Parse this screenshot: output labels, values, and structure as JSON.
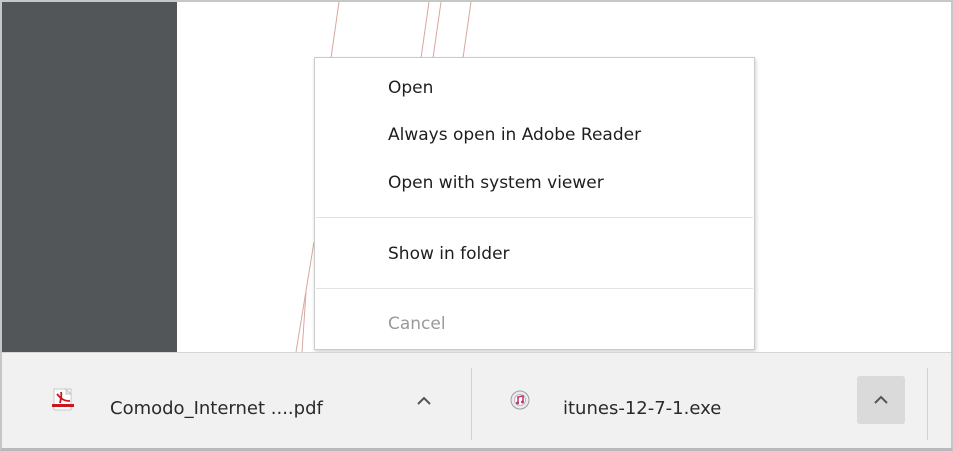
{
  "context_menu": {
    "items": [
      {
        "label": "Open",
        "enabled": true
      },
      {
        "label": "Always open in Adobe Reader",
        "enabled": true
      },
      {
        "label": "Open with system viewer",
        "enabled": true
      },
      {
        "label": "Show in folder",
        "enabled": true
      },
      {
        "label": "Cancel",
        "enabled": false
      }
    ]
  },
  "download_shelf": {
    "items": [
      {
        "file_name": "Comodo_Internet ....pdf",
        "icon": "pdf-file-icon"
      },
      {
        "file_name": "itunes-12-7-1.exe",
        "icon": "installer-file-icon"
      }
    ],
    "chevron_icon": "chevron-up-icon"
  },
  "colors": {
    "sidebar": "#525659",
    "shelf": "#f1f1f1",
    "pdf_red": "#c8171e",
    "disabled_text": "#9a9a9a"
  }
}
